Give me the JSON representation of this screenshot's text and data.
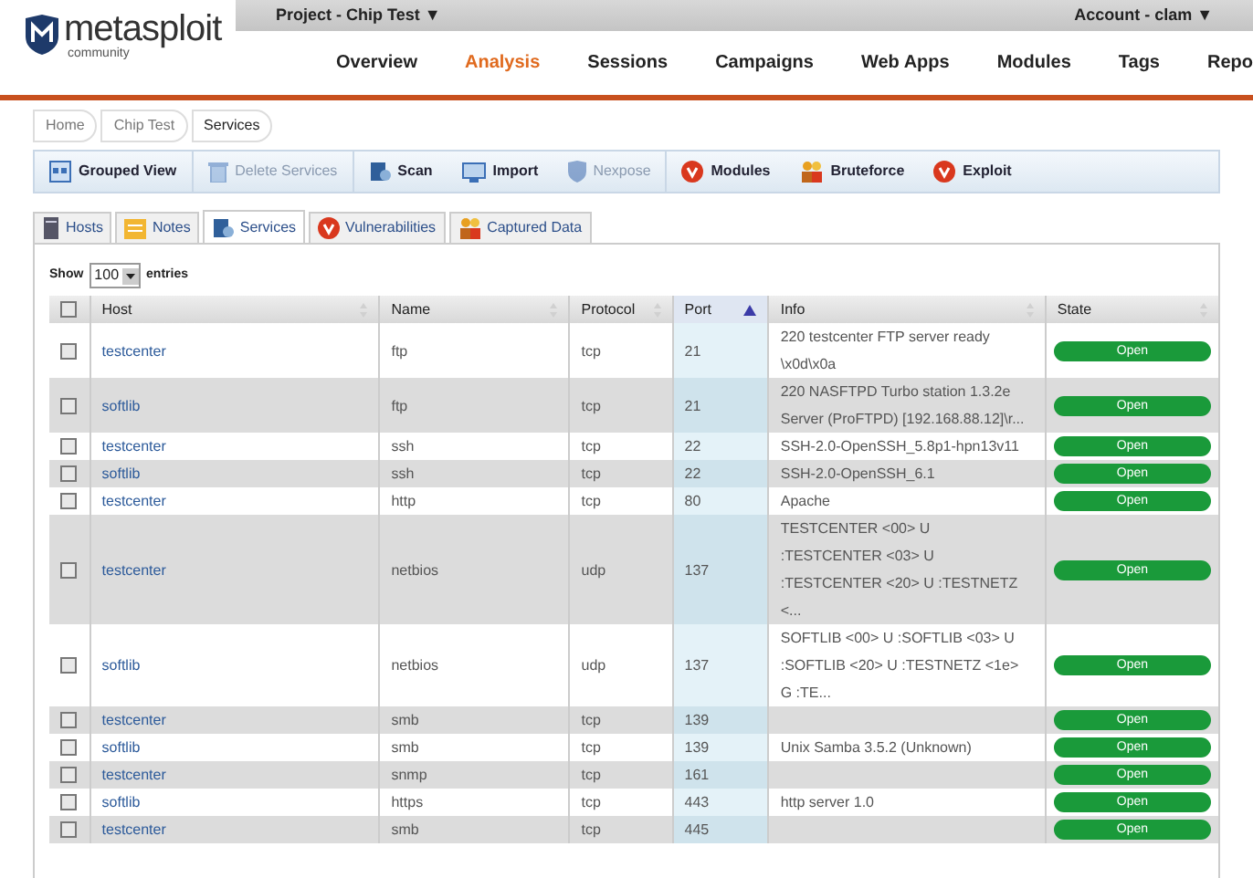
{
  "logo": {
    "name": "metasploit",
    "edition": "community"
  },
  "project_menu": "Project - Chip Test ▼",
  "account_menu": "Account - clam ▼",
  "nav": [
    {
      "label": "Overview",
      "selected": false
    },
    {
      "label": "Analysis",
      "selected": true
    },
    {
      "label": "Sessions",
      "selected": false
    },
    {
      "label": "Campaigns",
      "selected": false
    },
    {
      "label": "Web Apps",
      "selected": false
    },
    {
      "label": "Modules",
      "selected": false
    },
    {
      "label": "Tags",
      "selected": false
    },
    {
      "label": "Repo",
      "selected": false
    }
  ],
  "breadcrumb": [
    "Home",
    "Chip Test",
    "Services"
  ],
  "toolbar": [
    {
      "label": "Grouped View",
      "kind": "grid",
      "disabled": false
    },
    {
      "label": "Delete Services",
      "kind": "trash",
      "disabled": true
    },
    {
      "label": "Scan",
      "kind": "scan",
      "disabled": false
    },
    {
      "label": "Import",
      "kind": "import",
      "disabled": false
    },
    {
      "label": "Nexpose",
      "kind": "shield",
      "disabled": true
    },
    {
      "label": "Modules",
      "kind": "badge",
      "disabled": false
    },
    {
      "label": "Bruteforce",
      "kind": "brute",
      "disabled": false
    },
    {
      "label": "Exploit",
      "kind": "badge",
      "disabled": false
    }
  ],
  "tabs": [
    {
      "label": "Hosts",
      "kind": "hosts",
      "selected": false
    },
    {
      "label": "Notes",
      "kind": "notes",
      "selected": false
    },
    {
      "label": "Services",
      "kind": "scan",
      "selected": true
    },
    {
      "label": "Vulnerabilities",
      "kind": "badge",
      "selected": false
    },
    {
      "label": "Captured Data",
      "kind": "brute",
      "selected": false
    }
  ],
  "show_entries": {
    "prefix": "Show",
    "value": "100",
    "suffix": "entries"
  },
  "table": {
    "select_all": {
      "checked": false
    },
    "columns": [
      {
        "label": "Host",
        "sorted": false
      },
      {
        "label": "Name",
        "sorted": false
      },
      {
        "label": "Protocol",
        "sorted": false
      },
      {
        "label": "Port",
        "sorted": true
      },
      {
        "label": "Info",
        "sorted": false
      },
      {
        "label": "State",
        "sorted": false
      }
    ],
    "rows": [
      {
        "checked": false,
        "host": "testcenter",
        "name": "ftp",
        "protocol": "tcp",
        "port": "21",
        "info": "220 testcenter FTP server ready \\x0d\\x0a",
        "state": "Open"
      },
      {
        "checked": false,
        "host": "softlib",
        "name": "ftp",
        "protocol": "tcp",
        "port": "21",
        "info": "220 NASFTPD Turbo station 1.3.2e Server (ProFTPD) [192.168.88.12]\\r...",
        "state": "Open"
      },
      {
        "checked": false,
        "host": "testcenter",
        "name": "ssh",
        "protocol": "tcp",
        "port": "22",
        "info": "SSH-2.0-OpenSSH_5.8p1-hpn13v11",
        "state": "Open"
      },
      {
        "checked": false,
        "host": "softlib",
        "name": "ssh",
        "protocol": "tcp",
        "port": "22",
        "info": "SSH-2.0-OpenSSH_6.1",
        "state": "Open"
      },
      {
        "checked": false,
        "host": "testcenter",
        "name": "http",
        "protocol": "tcp",
        "port": "80",
        "info": "Apache",
        "state": "Open"
      },
      {
        "checked": false,
        "host": "testcenter",
        "name": "netbios",
        "protocol": "udp",
        "port": "137",
        "info": "TESTCENTER <00> U :TESTCENTER <03> U :TESTCENTER <20> U :TESTNETZ <...",
        "state": "Open"
      },
      {
        "checked": false,
        "host": "softlib",
        "name": "netbios",
        "protocol": "udp",
        "port": "137",
        "info": "SOFTLIB <00> U :SOFTLIB <03> U :SOFTLIB <20> U :TESTNETZ <1e> G :TE...",
        "state": "Open"
      },
      {
        "checked": false,
        "host": "testcenter",
        "name": "smb",
        "protocol": "tcp",
        "port": "139",
        "state": "Open"
      },
      {
        "checked": false,
        "host": "softlib",
        "name": "smb",
        "protocol": "tcp",
        "port": "139",
        "info": "Unix Samba 3.5.2 (Unknown)",
        "state": "Open"
      },
      {
        "checked": false,
        "host": "testcenter",
        "name": "snmp",
        "protocol": "tcp",
        "port": "161",
        "state": "Open"
      },
      {
        "checked": false,
        "host": "softlib",
        "name": "https",
        "protocol": "tcp",
        "port": "443",
        "info": "http server 1.0",
        "state": "Open"
      },
      {
        "checked": false,
        "host": "testcenter",
        "name": "smb",
        "protocol": "tcp",
        "port": "445",
        "state": "Open"
      }
    ]
  }
}
